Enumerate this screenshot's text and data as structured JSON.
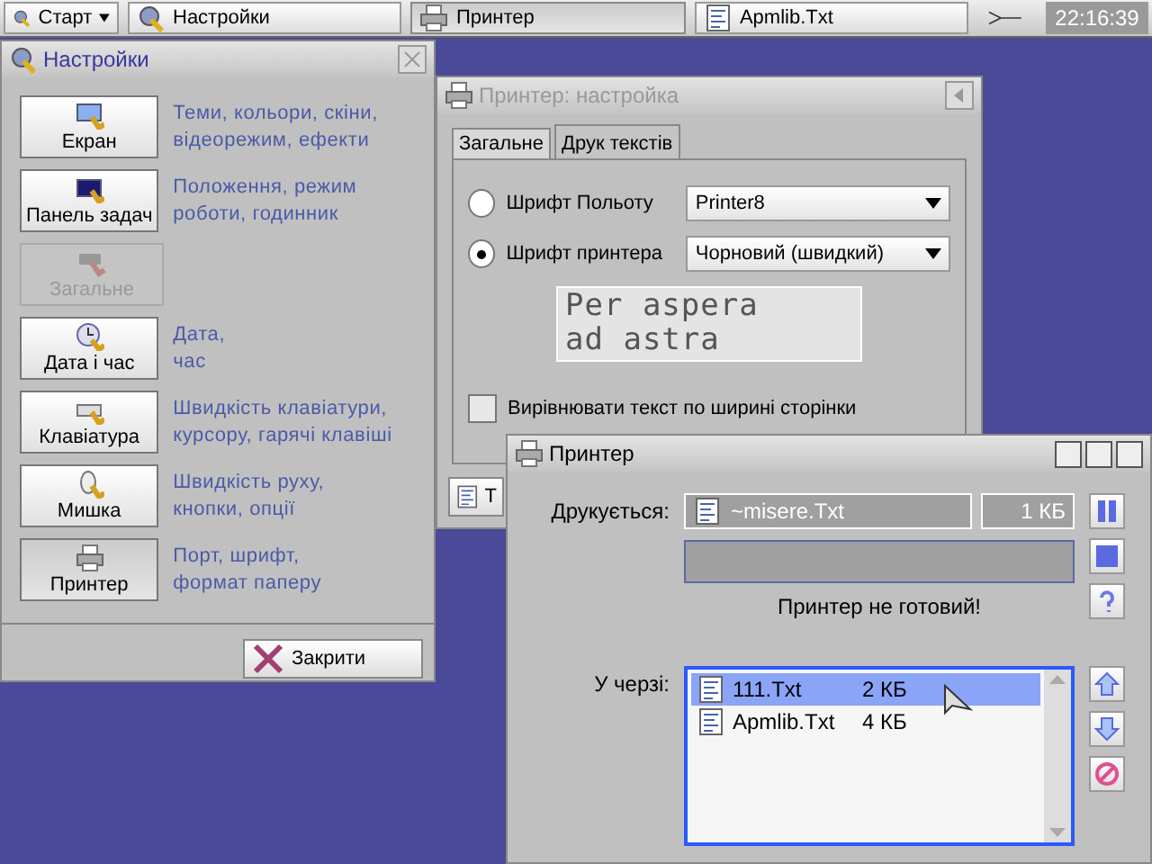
{
  "taskbar": {
    "start": "Старт",
    "tasks": [
      {
        "label": "Настройки",
        "selected": false
      },
      {
        "label": "Принтер",
        "selected": true
      },
      {
        "label": "Apmlib.Txt",
        "selected": false
      }
    ],
    "clock": "22:16:39"
  },
  "settings_window": {
    "title": "Настройки",
    "items": [
      {
        "label": "Екран",
        "description": [
          "Теми, кольори, скіни,",
          "відеорежим, ефекти"
        ],
        "disabled": false
      },
      {
        "label": "Панель задач",
        "description": [
          "Положення, режим",
          "роботи, годинник"
        ],
        "disabled": false
      },
      {
        "label": "Загальне",
        "disabled": true
      },
      {
        "label": "Дата і час",
        "description": [
          "Дата,",
          "час"
        ],
        "disabled": false
      },
      {
        "label": "Клавіатура",
        "description": [
          "Швидкість клавіатури,",
          "курсору, гарячі клавіші"
        ],
        "disabled": false
      },
      {
        "label": "Мишка",
        "description": [
          "Швидкість руху,",
          "кнопки, опції"
        ],
        "disabled": false
      },
      {
        "label": "Принтер",
        "description": [
          "Порт, шрифт,",
          "формат паперу"
        ],
        "disabled": false
      }
    ],
    "close_button": "Закрити"
  },
  "printer_settings_window": {
    "title": "Принтер: настройка",
    "tabs": [
      {
        "label": "Загальне",
        "selected": false
      },
      {
        "label": "Друк текстів",
        "selected": true
      }
    ],
    "font_options": [
      {
        "label": "Шрифт Польоту",
        "value": "Printer8",
        "selected": false
      },
      {
        "label": "Шрифт принтера",
        "value": "Чорновий (швидкий)",
        "selected": true
      }
    ],
    "preview": [
      "Per aspera",
      "ad astra"
    ],
    "justify_checkbox": {
      "label": "Вирівнювати текст по ширині сторінки",
      "checked": false
    },
    "bottom_button": "Т"
  },
  "printer_window": {
    "title": "Принтер",
    "printing_label": "Друкується:",
    "current_file": "~misere.Txt",
    "current_size": "1 КБ",
    "progress": {
      "level": 0
    },
    "status": "Принтер не готовий!",
    "queue_label": "У черзі:",
    "queue": [
      {
        "name": "111.Txt",
        "size": "2 КБ",
        "selected": true
      },
      {
        "name": "Apmlib.Txt",
        "size": "4 КБ",
        "selected": false
      }
    ]
  }
}
